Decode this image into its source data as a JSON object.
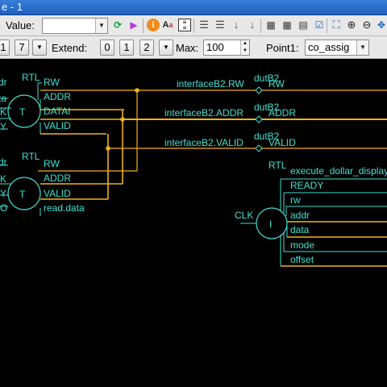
{
  "window": {
    "title": "e - 1"
  },
  "toolbar1": {
    "value_label": "Value:",
    "value_input": "",
    "icons": [
      "green-cycle-icon",
      "purple-play-icon",
      "info-icon",
      "font-search-icon",
      "document-icon",
      "list-icon",
      "list-alt-icon",
      "down-arrow-icon",
      "down-arrow-alt-icon",
      "grid-icon",
      "checkbox-icon",
      "fit-view-icon",
      "zoom-in-icon",
      "zoom-out-icon",
      "move-icon"
    ]
  },
  "toolbar2": {
    "step_a": "1",
    "step_b": "7",
    "extend_label": "Extend:",
    "extend_options": [
      "0",
      "1",
      "2"
    ],
    "max_label": "Max:",
    "max_value": "100",
    "point1_label": "Point1:",
    "point1_value": "co_assig"
  },
  "schematic": {
    "accent": "#f2b21e",
    "text_color": "#3fe0d0",
    "inst1": {
      "rtl": "RTL",
      "symbol": "T",
      "left_cut": [
        "dr",
        "ta",
        "K",
        "Y"
      ],
      "ports": [
        "RW",
        "ADDR",
        "DATAI",
        "VALID"
      ]
    },
    "inst2": {
      "rtl": "RTL",
      "symbol": "T",
      "left_cut": [
        "dr",
        "K",
        "Y",
        "O"
      ],
      "ports": [
        "RW",
        "ADDR",
        "VALID",
        "read.data"
      ]
    },
    "iface_nets": [
      {
        "name": "interfaceB2.RW",
        "top": "dutB2",
        "target": "RW"
      },
      {
        "name": "interfaceB2.ADDR",
        "top": "dutB2",
        "target": "ADDR"
      },
      {
        "name": "interfaceB2.VALID",
        "top": "dutB2",
        "target": "VALID"
      }
    ],
    "inst3": {
      "rtl": "RTL",
      "symbol": "I",
      "clk": "CLK",
      "ports": [
        "execute_dollar_display",
        "READY",
        "rw",
        "addr",
        "data",
        "mode",
        "offset"
      ]
    }
  }
}
